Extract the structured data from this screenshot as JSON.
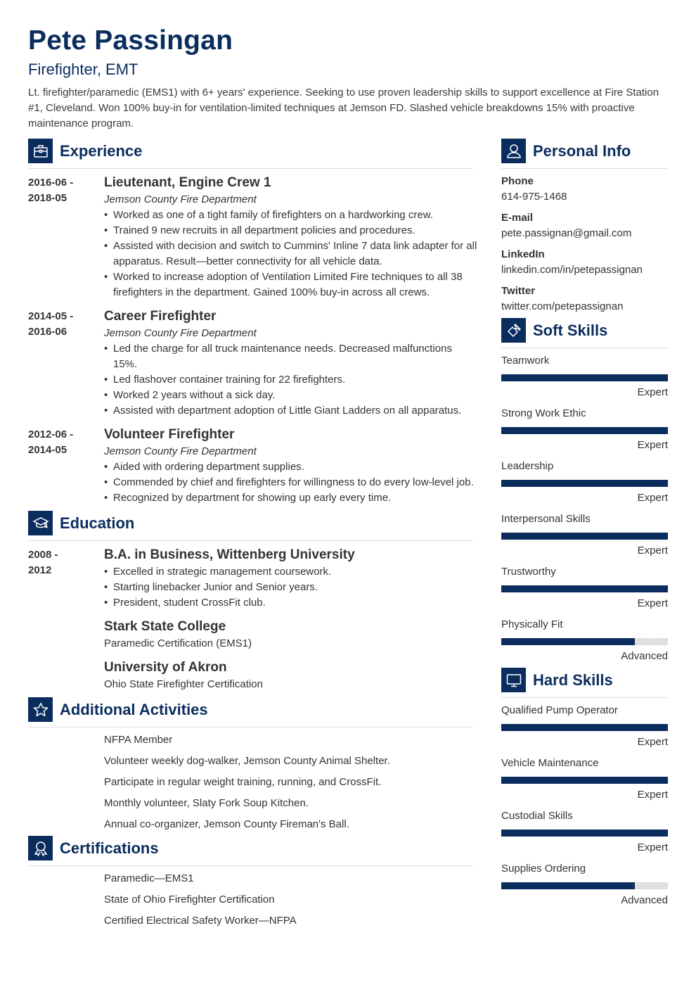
{
  "header": {
    "name": "Pete Passingan",
    "title": "Firefighter, EMT",
    "summary": "Lt. firefighter/paramedic (EMS1) with 6+ years' experience. Seeking to use proven leadership skills to support excellence at Fire Station #1, Cleveland. Won 100% buy-in for ventilation-limited techniques at Jemson FD. Slashed vehicle breakdowns 15% with proactive maintenance program."
  },
  "colors": {
    "accent": "#0b2d5e",
    "text": "#333333",
    "divider": "#dedede"
  },
  "experience": {
    "heading": "Experience",
    "icon": "briefcase-icon",
    "jobs": [
      {
        "date_start": "2016-06 -",
        "date_end": "2018-05",
        "role": "Lieutenant, Engine Crew 1",
        "org": "Jemson County Fire Department",
        "bullets": [
          "Worked as one of a tight family of firefighters on a hardworking crew.",
          "Trained 9 new recruits in all department policies and procedures.",
          "Assisted with decision and switch to Cummins' Inline 7 data link adapter for all apparatus. Result—better connectivity for all vehicle data.",
          "Worked to increase adoption of Ventilation Limited Fire techniques to all 38 firefighters in the department. Gained 100% buy-in across all crews."
        ]
      },
      {
        "date_start": "2014-05 -",
        "date_end": "2016-06",
        "role": "Career Firefighter",
        "org": "Jemson County Fire Department",
        "bullets": [
          "Led the charge for all truck maintenance needs. Decreased malfunctions 15%.",
          "Led flashover container training for 22 firefighters.",
          "Worked 2 years without a sick day.",
          "Assisted with department adoption of Little Giant Ladders on all apparatus."
        ]
      },
      {
        "date_start": "2012-06 -",
        "date_end": "2014-05",
        "role": "Volunteer Firefighter",
        "org": "Jemson County Fire Department",
        "bullets": [
          "Aided with ordering department supplies.",
          "Commended by chief and firefighters for willingness to do every low-level job.",
          "Recognized by department for showing up early every time."
        ]
      }
    ]
  },
  "education": {
    "heading": "Education",
    "icon": "graduation-cap-icon",
    "items": [
      {
        "date_start": "2008 -",
        "date_end": "2012",
        "degree": "B.A. in Business, Wittenberg University",
        "bullets": [
          "Excelled in strategic management coursework.",
          "Starting linebacker Junior and Senior years.",
          "President, student CrossFit club."
        ]
      },
      {
        "degree": "Stark State College",
        "detail": "Paramedic Certification (EMS1)"
      },
      {
        "degree": "University of Akron",
        "detail": "Ohio State Firefighter Certification"
      }
    ]
  },
  "activities": {
    "heading": "Additional Activities",
    "icon": "star-icon",
    "items": [
      "NFPA Member",
      "Volunteer weekly dog-walker, Jemson County Animal Shelter.",
      "Participate in regular weight training, running, and CrossFit.",
      "Monthly volunteer, Slaty Fork Soup Kitchen.",
      "Annual co-organizer, Jemson County Fireman's Ball."
    ]
  },
  "certifications": {
    "heading": "Certifications",
    "icon": "award-ribbon-icon",
    "items": [
      "Paramedic—EMS1",
      "State of Ohio Firefighter Certification",
      "Certified Electrical Safety Worker—NFPA"
    ]
  },
  "personal_info": {
    "heading": "Personal Info",
    "icon": "user-icon",
    "fields": [
      {
        "label": "Phone",
        "value": "614-975-1468"
      },
      {
        "label": "E-mail",
        "value": "pete.passignan@gmail.com"
      },
      {
        "label": "LinkedIn",
        "value": "linkedin.com/in/petepassignan"
      },
      {
        "label": "Twitter",
        "value": "twitter.com/petepassignan"
      }
    ]
  },
  "soft_skills": {
    "heading": "Soft Skills",
    "icon": "puzzle-icon",
    "items": [
      {
        "name": "Teamwork",
        "level": "Expert",
        "proficiency": 1.0
      },
      {
        "name": "Strong Work Ethic",
        "level": "Expert",
        "proficiency": 1.0
      },
      {
        "name": "Leadership",
        "level": "Expert",
        "proficiency": 1.0
      },
      {
        "name": "Interpersonal Skills",
        "level": "Expert",
        "proficiency": 1.0
      },
      {
        "name": "Trustworthy",
        "level": "Expert",
        "proficiency": 1.0
      },
      {
        "name": "Physically Fit",
        "level": "Advanced",
        "proficiency": 0.8
      }
    ]
  },
  "hard_skills": {
    "heading": "Hard Skills",
    "icon": "monitor-icon",
    "items": [
      {
        "name": "Qualified Pump Operator",
        "level": "Expert",
        "proficiency": 1.0
      },
      {
        "name": "Vehicle Maintenance",
        "level": "Expert",
        "proficiency": 1.0
      },
      {
        "name": "Custodial Skills",
        "level": "Expert",
        "proficiency": 1.0
      },
      {
        "name": "Supplies Ordering",
        "level": "Advanced",
        "proficiency": 0.8
      }
    ]
  }
}
